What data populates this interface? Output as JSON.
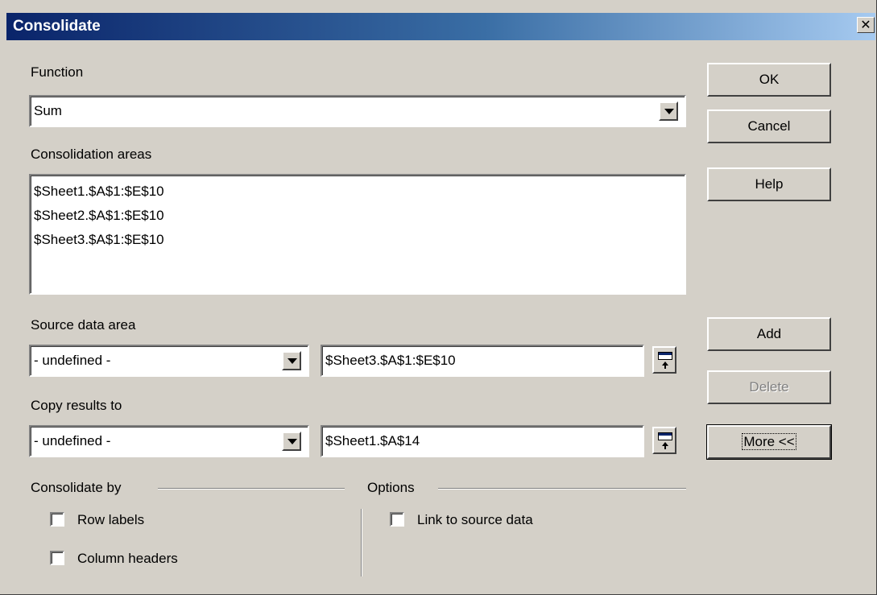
{
  "window": {
    "title": "Consolidate",
    "close_glyph": "✕"
  },
  "function": {
    "label": "Function",
    "value": "Sum"
  },
  "consolidation_areas": {
    "label": "Consolidation areas",
    "items": [
      "$Sheet1.$A$1:$E$10",
      "$Sheet2.$A$1:$E$10",
      "$Sheet3.$A$1:$E$10"
    ]
  },
  "source": {
    "label": "Source data area",
    "dropdown_value": "- undefined -",
    "range": "$Sheet3.$A$1:$E$10"
  },
  "copy": {
    "label": "Copy results to",
    "dropdown_value": "- undefined -",
    "range": "$Sheet1.$A$14"
  },
  "buttons": {
    "ok": "OK",
    "cancel": "Cancel",
    "help": "Help",
    "add": "Add",
    "delete": "Delete",
    "more": "More <<"
  },
  "consolidate_by": {
    "label": "Consolidate by",
    "row_labels": "Row labels",
    "column_headers": "Column headers"
  },
  "options": {
    "label": "Options",
    "link": "Link to source data"
  }
}
